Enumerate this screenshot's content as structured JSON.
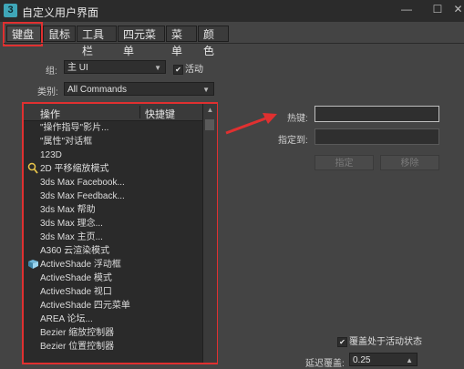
{
  "window": {
    "icon_glyph": "3",
    "title": "自定义用户界面",
    "controls": [
      "—",
      "☐",
      "✕"
    ]
  },
  "tabs": [
    {
      "label": "键盘",
      "active": true
    },
    {
      "label": "鼠标",
      "active": false
    },
    {
      "label": "工具栏",
      "active": false
    },
    {
      "label": "四元菜单",
      "active": false
    },
    {
      "label": "菜单",
      "active": false
    },
    {
      "label": "颜色",
      "active": false
    }
  ],
  "group": {
    "label": "组:",
    "value": "主 UI",
    "active_checked": true,
    "active_label": "活动"
  },
  "category": {
    "label": "类别:",
    "value": "All Commands"
  },
  "list": {
    "col_action": "操作",
    "col_shortcut": "快捷键",
    "items": [
      {
        "icon": "",
        "label": "\"操作指导\"影片..."
      },
      {
        "icon": "",
        "label": "\"属性\"对话框"
      },
      {
        "icon": "",
        "label": "123D"
      },
      {
        "icon": "magnifier-icon",
        "label": "2D 平移缩放模式"
      },
      {
        "icon": "",
        "label": "3ds Max Facebook..."
      },
      {
        "icon": "",
        "label": "3ds Max Feedback..."
      },
      {
        "icon": "",
        "label": "3ds Max 帮助"
      },
      {
        "icon": "",
        "label": "3ds Max 理念..."
      },
      {
        "icon": "",
        "label": "3ds Max 主页..."
      },
      {
        "icon": "",
        "label": "A360 云渲染模式"
      },
      {
        "icon": "activeshade-icon",
        "label": "ActiveShade 浮动框"
      },
      {
        "icon": "",
        "label": "ActiveShade 模式"
      },
      {
        "icon": "",
        "label": "ActiveShade 视口"
      },
      {
        "icon": "",
        "label": "ActiveShade 四元菜单"
      },
      {
        "icon": "",
        "label": "AREA 论坛..."
      },
      {
        "icon": "",
        "label": "Bezier 缩放控制器"
      },
      {
        "icon": "",
        "label": "Bezier 位置控制器"
      }
    ]
  },
  "hotkey": {
    "label": "热键:",
    "value": ""
  },
  "assigned_to": {
    "label": "指定到:",
    "value": ""
  },
  "buttons": {
    "assign": "指定",
    "remove": "移除"
  },
  "overwrite": {
    "checked": true,
    "label": "覆盖处于活动状态"
  },
  "delay": {
    "label": "延迟覆盖:",
    "value": "0.25"
  }
}
